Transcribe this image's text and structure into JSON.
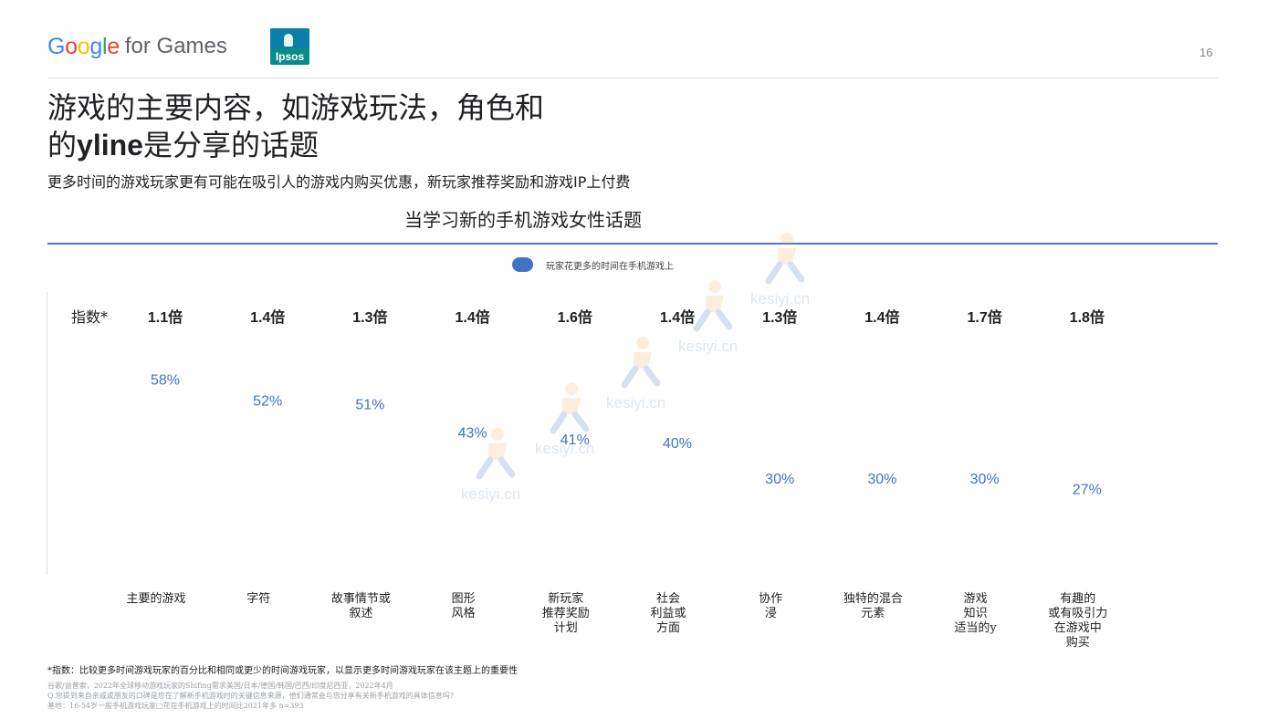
{
  "header": {
    "brand_google": "Google",
    "brand_rest": "for Games",
    "ipsos_logo": "Ipsos",
    "page_number": "16",
    "google_colors": [
      "#4285F4",
      "#EA4335",
      "#FBBC05",
      "#4285F4",
      "#34A853",
      "#EA4335"
    ]
  },
  "title": {
    "line1": "游戏的主要内容，如游戏玩法，角色和",
    "line2_prefix": "的",
    "line2_bold": "yline",
    "line2_suffix": "是分享的话题"
  },
  "subtitle": "更多时间的游戏玩家更有可能在吸引人的游戏内购买优惠，新玩家推荐奖励和游戏IP上付费",
  "chart_data": {
    "type": "scatter",
    "title": "当学习新的手机游戏女性话题",
    "legend": [
      "玩家花更多的时间在手机游戏上"
    ],
    "legend_position": "top-center",
    "series_color": "#3f74c2",
    "index_label": "指数*",
    "categories": [
      [
        "主要的游戏"
      ],
      [
        "字符"
      ],
      [
        "故事情节或",
        "叙述"
      ],
      [
        "图形",
        "风格"
      ],
      [
        "新玩家",
        "推荐奖励",
        "计划"
      ],
      [
        "社会",
        "利益或",
        "方面"
      ],
      [
        "协作",
        "浸"
      ],
      [
        "独特的混合",
        "元素"
      ],
      [
        "游戏",
        "知识",
        "适当的y"
      ],
      [
        "有趣的",
        "或有吸引力",
        "在游戏中",
        "购买"
      ]
    ],
    "values": [
      58,
      52,
      51,
      43,
      41,
      40,
      30,
      30,
      30,
      27
    ],
    "value_labels": [
      "58%",
      "52%",
      "51%",
      "43%",
      "41%",
      "40%",
      "30%",
      "30%",
      "30%",
      "27%"
    ],
    "index_values": [
      "1.1倍",
      "1.4倍",
      "1.3倍",
      "1.4倍",
      "1.6倍",
      "1.4倍",
      "1.3倍",
      "1.4倍",
      "1.7倍",
      "1.8倍"
    ],
    "ylim": [
      0,
      80
    ],
    "grid": false
  },
  "watermark": "kesiyi.cn",
  "footer": {
    "note": "*指数：比较更多时间游戏玩家的百分比和相同或更少的时间游戏玩家，以显示更多时间游戏玩家在该主题上的重要性",
    "source": "谷歌/益普索，2022年全球移动游戏玩家的Shifing需求美国/日本/德国/韩国/巴西/印度尼西亚，2022年4月",
    "question": "Q.您提到来自亲戚或朋友的口碑是您在了解新手机游戏时的关键信息来源，他们通常会与您分享有关新手机游戏的具体信息吗?",
    "base": "基地：16-54岁一般手机游戏玩家□花在手机游戏上的时间比2021年多 n=393"
  }
}
